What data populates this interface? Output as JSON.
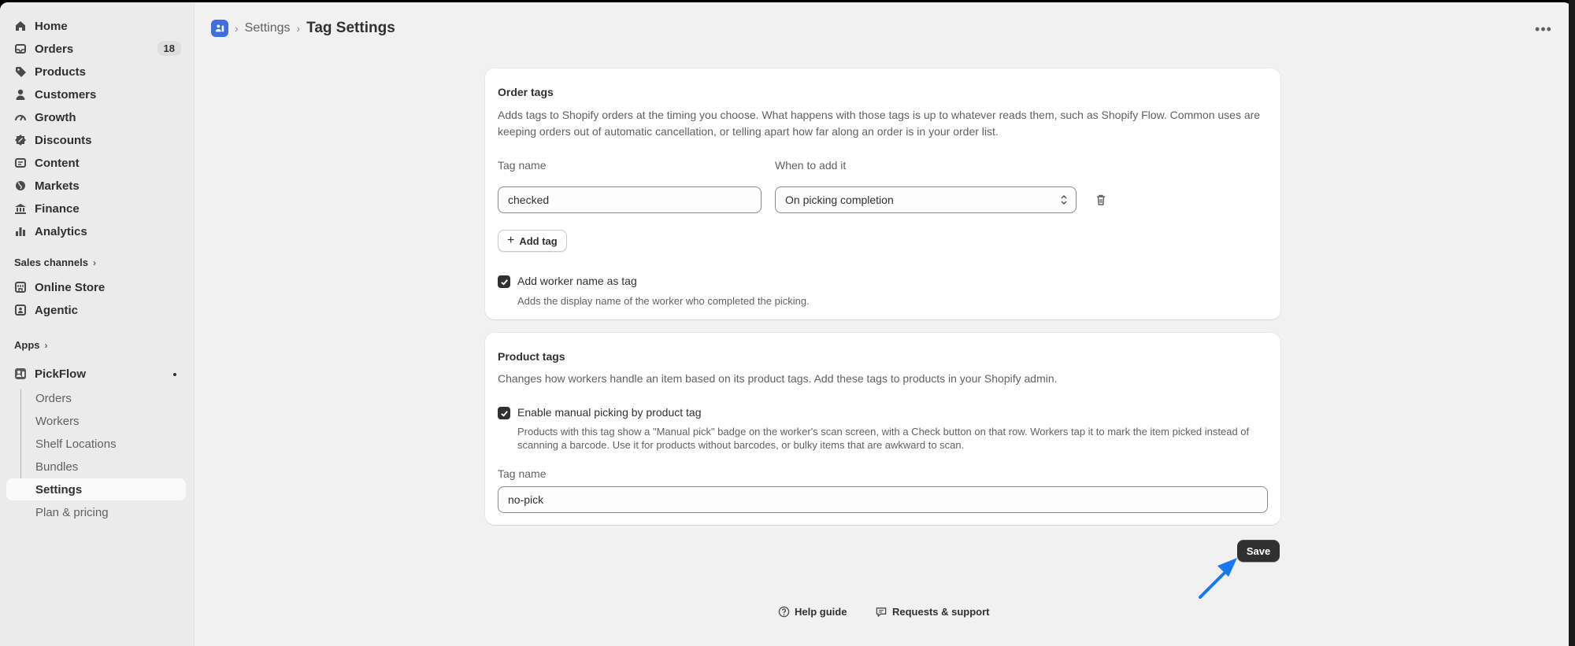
{
  "sidebar": {
    "items": [
      {
        "label": "Home",
        "icon": "home-icon"
      },
      {
        "label": "Orders",
        "icon": "inbox-icon",
        "badge": "18"
      },
      {
        "label": "Products",
        "icon": "tag-icon"
      },
      {
        "label": "Customers",
        "icon": "person-icon"
      },
      {
        "label": "Growth",
        "icon": "gauge-icon"
      },
      {
        "label": "Discounts",
        "icon": "discount-icon"
      },
      {
        "label": "Content",
        "icon": "content-icon"
      },
      {
        "label": "Markets",
        "icon": "globe-icon"
      },
      {
        "label": "Finance",
        "icon": "bank-icon"
      },
      {
        "label": "Analytics",
        "icon": "bar-chart-icon"
      }
    ],
    "sales_channels_label": "Sales channels",
    "channels": [
      {
        "label": "Online Store",
        "icon": "store-icon"
      },
      {
        "label": "Agentic",
        "icon": "agent-icon"
      }
    ],
    "apps_label": "Apps",
    "app": {
      "label": "PickFlow",
      "icon": "pickflow-icon"
    },
    "app_items": [
      {
        "label": "Orders"
      },
      {
        "label": "Workers"
      },
      {
        "label": "Shelf Locations"
      },
      {
        "label": "Bundles"
      },
      {
        "label": "Settings",
        "active": true
      },
      {
        "label": "Plan & pricing"
      }
    ]
  },
  "header": {
    "breadcrumb_parent": "Settings",
    "title": "Tag Settings"
  },
  "order_tags": {
    "title": "Order tags",
    "description": "Adds tags to Shopify orders at the timing you choose. What happens with those tags is up to whatever reads them, such as Shopify Flow. Common uses are keeping orders out of automatic cancellation, or telling apart how far along an order is in your order list.",
    "tag_name_label": "Tag name",
    "when_label": "When to add it",
    "tag_value": "checked",
    "when_value": "On picking completion",
    "add_tag_label": "Add tag",
    "worker_checkbox_label": "Add worker name as tag",
    "worker_checkbox_checked": true,
    "worker_checkbox_help": "Adds the display name of the worker who completed the picking."
  },
  "product_tags": {
    "title": "Product tags",
    "description": "Changes how workers handle an item based on its product tags. Add these tags to products in your Shopify admin.",
    "manual_checkbox_label": "Enable manual picking by product tag",
    "manual_checkbox_checked": true,
    "manual_checkbox_help": "Products with this tag show a \"Manual pick\" badge on the worker's scan screen, with a Check button on that row. Workers tap it to mark the item picked instead of scanning a barcode. Use it for products without barcodes, or bulky items that are awkward to scan.",
    "tag_name_label": "Tag name",
    "tag_value": "no-pick"
  },
  "actions": {
    "save_label": "Save"
  },
  "footer": {
    "help_label": "Help guide",
    "support_label": "Requests & support"
  },
  "colors": {
    "accent": "#3f6ee0",
    "primary_button": "#303030",
    "arrow": "#1877f2"
  }
}
